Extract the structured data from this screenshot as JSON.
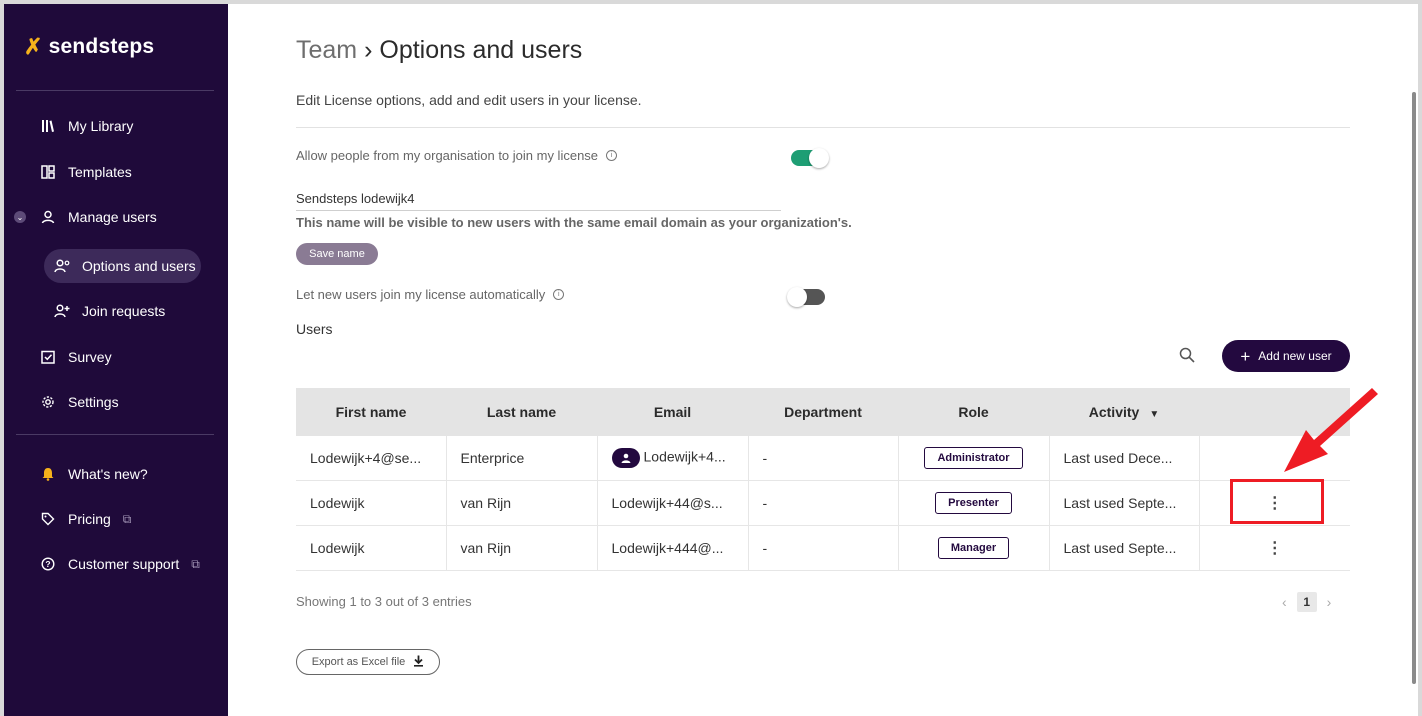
{
  "sidebar": {
    "logo_text": "sendsteps",
    "items": [
      {
        "label": "My Library",
        "icon": "library-icon"
      },
      {
        "label": "Templates",
        "icon": "templates-icon"
      },
      {
        "label": "Manage users",
        "icon": "user-icon"
      },
      {
        "label": "Options and users",
        "icon": "user-settings-icon"
      },
      {
        "label": "Join requests",
        "icon": "user-add-icon"
      },
      {
        "label": "Survey",
        "icon": "checkbox-icon"
      },
      {
        "label": "Settings",
        "icon": "gear-icon"
      },
      {
        "label": "What's new?",
        "icon": "bell-icon"
      },
      {
        "label": "Pricing",
        "icon": "tag-icon"
      },
      {
        "label": "Customer support",
        "icon": "help-icon"
      }
    ]
  },
  "page": {
    "breadcrumb": "Team",
    "separator": "›",
    "title": "Options and users",
    "subtitle": "Edit License options, add and edit users in your license."
  },
  "options": {
    "allow_join_label": "Allow people from my organisation to join my license",
    "allow_join_enabled": true,
    "org_name_value": "Sendsteps lodewijk4",
    "org_name_hint": "This name will be visible to new users with the same email domain as your organization's.",
    "save_name_label": "Save name",
    "auto_join_label": "Let new users join my license automatically",
    "auto_join_enabled": false
  },
  "users": {
    "heading": "Users",
    "add_label": "Add new user",
    "columns": [
      "First name",
      "Last name",
      "Email",
      "Department",
      "Role",
      "Activity"
    ],
    "rows": [
      {
        "first": "Lodewijk+4@se...",
        "last": "Enterprice",
        "email": "Lodewijk+4...",
        "department": "-",
        "role": "Administrator",
        "activity": "Last used Dece..."
      },
      {
        "first": "Lodewijk",
        "last": "van Rijn",
        "email": "Lodewijk+44@s...",
        "department": "-",
        "role": "Presenter",
        "activity": "Last used Septe..."
      },
      {
        "first": "Lodewijk",
        "last": "van Rijn",
        "email": "Lodewijk+444@...",
        "department": "-",
        "role": "Manager",
        "activity": "Last used Septe..."
      }
    ],
    "showing": "Showing 1  to 3  out of 3 entries",
    "current_page": "1",
    "export_label": "Export as Excel file"
  },
  "colors": {
    "sidebar_bg": "#1f0a3a",
    "accent": "#23093f",
    "toggle_on": "#1e9e74",
    "highlight": "#ee1c24"
  }
}
